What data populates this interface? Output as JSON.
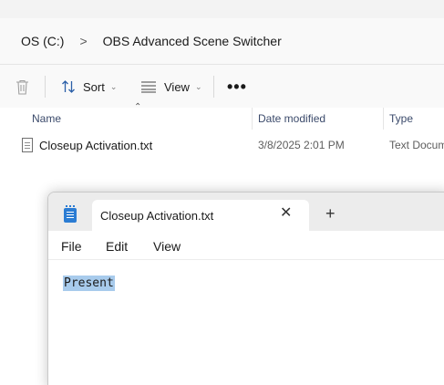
{
  "explorer": {
    "breadcrumb": [
      "OS (C:)",
      "OBS Advanced Scene Switcher"
    ],
    "breadcrumb_separator": ">",
    "toolbar": {
      "sort_label": "Sort",
      "view_label": "View",
      "more_label": "•••"
    },
    "columns": [
      "Name",
      "Date modified",
      "Type"
    ],
    "files": [
      {
        "name": "Closeup Activation.txt",
        "date_modified": "3/8/2025 2:01 PM",
        "type": "Text Docum"
      }
    ]
  },
  "notepad": {
    "tab_title": "Closeup Activation.txt",
    "tab_close": "✕",
    "new_tab": "+",
    "menu": [
      "File",
      "Edit",
      "View"
    ],
    "content": "Present",
    "selection_color": "#a8cbec"
  },
  "colors": {
    "explorer_bg": "#f9f9f9",
    "notepad_titlebar": "#ececec",
    "accent": "#2b7cd3"
  }
}
